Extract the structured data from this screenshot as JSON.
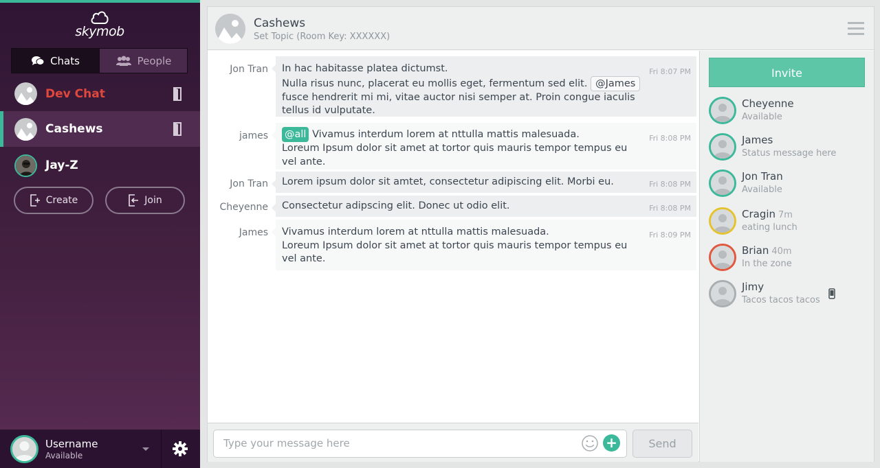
{
  "app": {
    "logo_text": "skymob",
    "accent": "#3cb89a"
  },
  "sidebar": {
    "tabs": [
      {
        "label": "Chats",
        "icon": "chat-bubbles-icon",
        "active": true
      },
      {
        "label": "People",
        "icon": "people-icon",
        "active": false
      }
    ],
    "rooms": [
      {
        "name": "Dev Chat",
        "color": "#e0483d",
        "selected": false
      },
      {
        "name": "Cashews",
        "color": "#ffffff",
        "selected": true
      },
      {
        "name": "Jay-Z",
        "color": "#ffffff",
        "selected": false
      }
    ],
    "create_label": "Create",
    "join_label": "Join",
    "user": {
      "name": "Username",
      "status": "Available"
    }
  },
  "room": {
    "title": "Cashews",
    "topic": "Set Topic (Room Key: XXXXXX)"
  },
  "messages": [
    {
      "author": "Jon Tran",
      "time": "Fri 8:07 PM",
      "line1": "In hac habitasse platea dictumst.",
      "line2a": "Nulla risus nunc, placerat eu mollis eget, fermentum sed elit.",
      "mention": "@James",
      "line3": "fusce hendrerit mi mi, vitae auctor nisi semper at. Proin congue iaculis",
      "line4": "tellus id vulputate."
    },
    {
      "author": "james",
      "time": "Fri 8:08 PM",
      "mention": "@all",
      "line1": "Vivamus interdum lorem at nttulla mattis malesuada.",
      "line2": "Loreum Ipsum dolor sit amet at tortor quis mauris tempor tempus eu",
      "line3": "vel ante."
    },
    {
      "author": "Jon Tran",
      "time": "Fri 8:08 PM",
      "line1": "Lorem ipsum dolor sit amtet, consectetur adipiscing elit. Morbi eu."
    },
    {
      "author": "Cheyenne",
      "time": "Fri 8:08 PM",
      "line1": "Consectetur adipscing elit. Donec ut odio elit."
    },
    {
      "author": "James",
      "time": "Fri 8:09 PM",
      "line1": "Vivamus interdum lorem at nttulla mattis malesuada.",
      "line2": "Loreum Ipsum dolor sit amet at tortor quis mauris tempor tempus eu",
      "line3": "vel ante."
    }
  ],
  "composer": {
    "placeholder": "Type your message here",
    "send_label": "Send"
  },
  "people": {
    "invite_label": "Invite",
    "list": [
      {
        "name": "Cheyenne",
        "ago": "",
        "status": "Available",
        "ring": "#3cb89a"
      },
      {
        "name": "James",
        "ago": "",
        "status": "Status message here",
        "ring": "#3cb89a"
      },
      {
        "name": "Jon Tran",
        "ago": "",
        "status": "Available",
        "ring": "#3cb89a"
      },
      {
        "name": "Cragin",
        "ago": "7m",
        "status": "eating lunch",
        "ring": "#e5c32e"
      },
      {
        "name": "Brian",
        "ago": "40m",
        "status": "In the zone",
        "ring": "#e0583d"
      },
      {
        "name": "Jimy",
        "ago": "",
        "status": "Tacos tacos tacos",
        "ring": "#a9aeb1",
        "mobile": true
      }
    ]
  }
}
